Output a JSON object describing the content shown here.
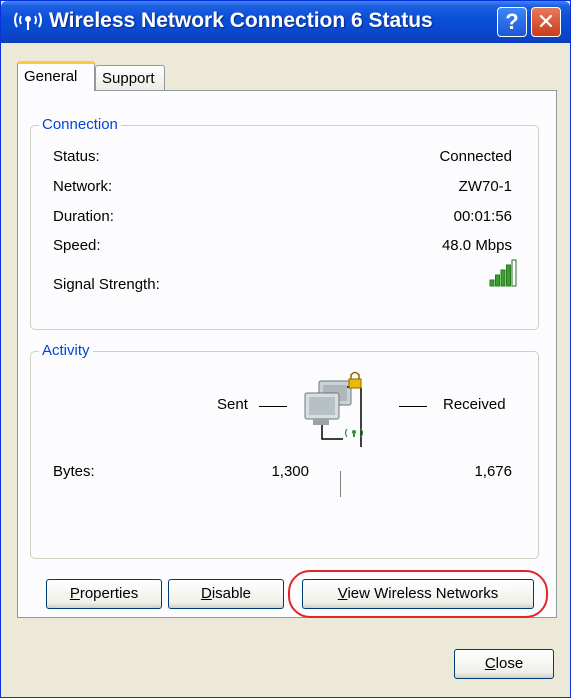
{
  "window": {
    "title": "Wireless Network Connection 6 Status",
    "help_label": "?",
    "close_label": "✕"
  },
  "tabs": [
    {
      "label": "General",
      "active": true
    },
    {
      "label": "Support",
      "active": false
    }
  ],
  "connection": {
    "legend": "Connection",
    "rows": [
      {
        "label": "Status:",
        "value": "Connected"
      },
      {
        "label": "Network:",
        "value": "ZW70-1"
      },
      {
        "label": "Duration:",
        "value": "00:01:56"
      },
      {
        "label": "Speed:",
        "value": "48.0 Mbps"
      },
      {
        "label": "Signal Strength:",
        "value": ""
      }
    ],
    "signal_bars_filled": 5,
    "signal_bars_total": 5
  },
  "activity": {
    "legend": "Activity",
    "sent_label": "Sent",
    "received_label": "Received",
    "bytes_label": "Bytes:",
    "bytes_sent": "1,300",
    "bytes_received": "1,676"
  },
  "buttons": {
    "properties": {
      "prefix": "",
      "mnemonic": "P",
      "rest": "roperties"
    },
    "disable": {
      "prefix": "",
      "mnemonic": "D",
      "rest": "isable"
    },
    "view_networks": {
      "prefix": "",
      "mnemonic": "V",
      "rest": "iew Wireless Networks"
    },
    "close": {
      "prefix": "",
      "mnemonic": "C",
      "rest": "lose"
    }
  },
  "colors": {
    "titlebar": "#0a4fd8",
    "legend_text": "#0046d5",
    "signal_green": "#3aa02c",
    "highlight_ring": "#e0252b"
  }
}
